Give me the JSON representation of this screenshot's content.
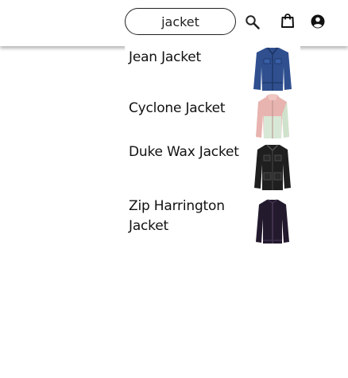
{
  "search": {
    "value": "jacket"
  },
  "header": {
    "icons": [
      "search-icon",
      "shopping-bag-icon",
      "account-icon"
    ]
  },
  "results": [
    {
      "title": "Jean Jacket",
      "thumbnail": "denim-jacket-image",
      "color": "#2f4f8f"
    },
    {
      "title": "Cyclone Jacket",
      "thumbnail": "pink-mint-windbreaker-image",
      "color": "#e8b4b0"
    },
    {
      "title": "Duke Wax Jacket",
      "thumbnail": "black-wax-jacket-image",
      "color": "#1f1f1f"
    },
    {
      "title": "Zip Harrington Jacket",
      "thumbnail": "navy-harrington-jacket-image",
      "color": "#241a2e"
    }
  ]
}
